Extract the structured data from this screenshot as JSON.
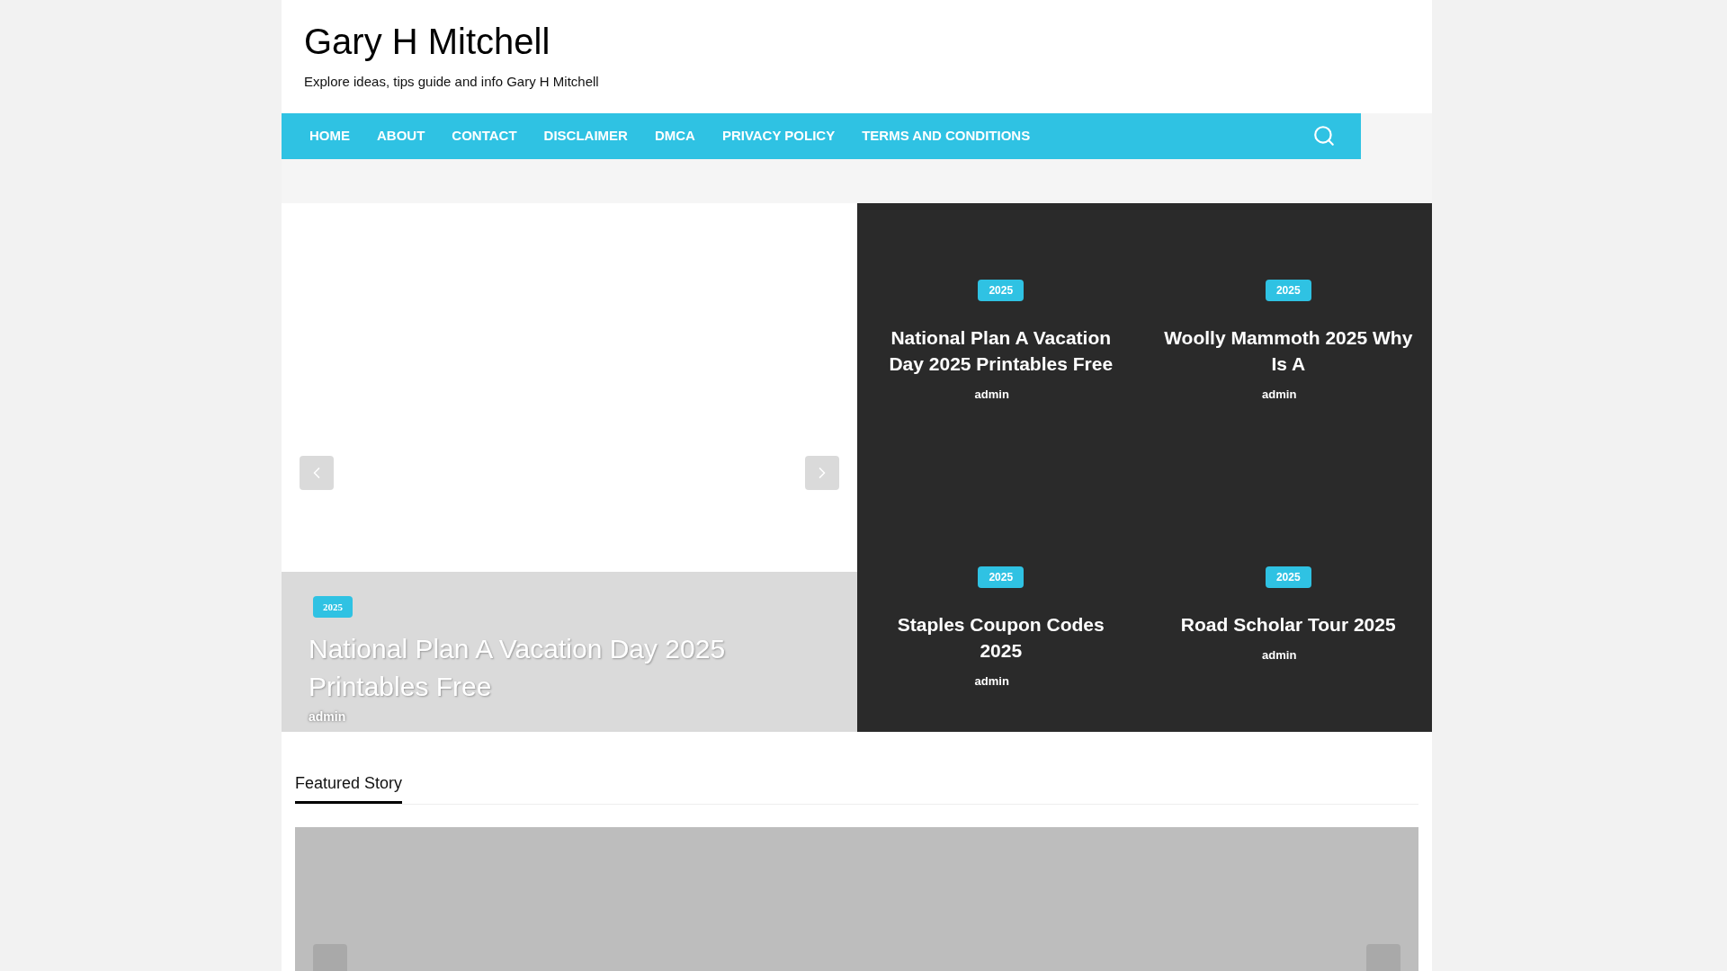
{
  "site": {
    "title": "Gary H Mitchell",
    "tagline": "Explore ideas, tips guide and info Gary H Mitchell"
  },
  "nav": [
    {
      "label": "HOME"
    },
    {
      "label": "ABOUT"
    },
    {
      "label": "CONTACT"
    },
    {
      "label": "DISCLAIMER"
    },
    {
      "label": "DMCA"
    },
    {
      "label": "PRIVACY POLICY"
    },
    {
      "label": "TERMS AND CONDITIONS"
    }
  ],
  "slider": {
    "category": "2025",
    "title": "National Plan A Vacation Day 2025 Printables Free",
    "author": "admin"
  },
  "grid_posts": [
    {
      "category": "2025",
      "title": "National Plan A Vacation Day 2025 Printables Free",
      "author": "admin"
    },
    {
      "category": "2025",
      "title": "Woolly Mammoth 2025 Why Is A",
      "author": "admin"
    },
    {
      "category": "2025",
      "title": "Staples Coupon Codes 2025",
      "author": "admin"
    },
    {
      "category": "2025",
      "title": "Road Scholar Tour 2025",
      "author": "admin"
    }
  ],
  "featured": {
    "heading": "Featured Story"
  }
}
